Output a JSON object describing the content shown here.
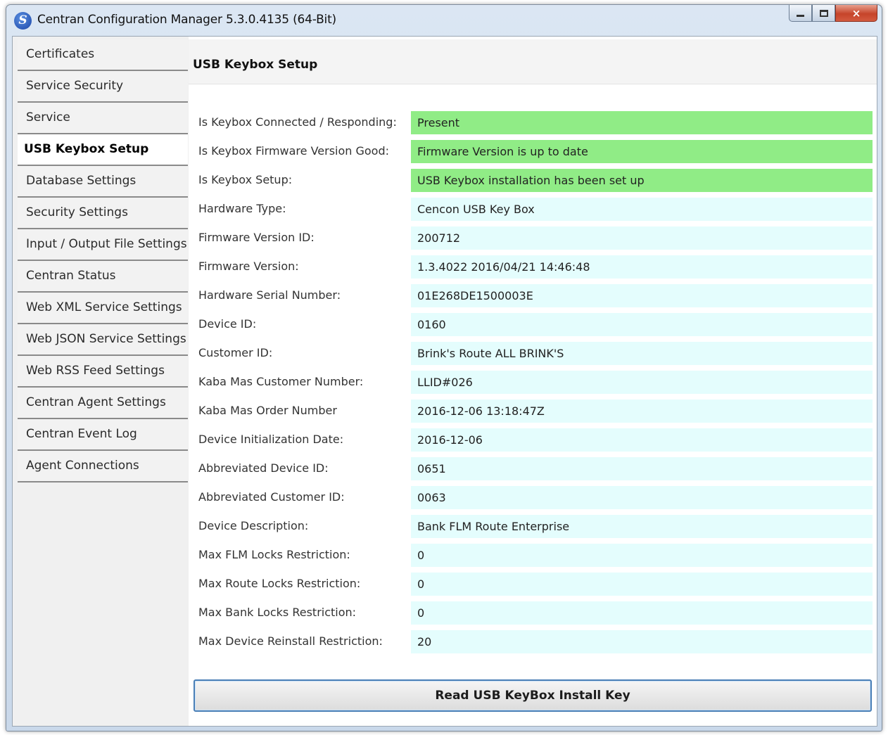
{
  "window": {
    "title": "Centran Configuration Manager 5.3.0.4135 (64-Bit)",
    "icon": "app-logo-icon",
    "controls": {
      "minimize": "minimize-icon",
      "maximize": "maximize-icon",
      "close": "×"
    }
  },
  "sidebar": {
    "items": [
      {
        "label": "Certificates"
      },
      {
        "label": "Service Security"
      },
      {
        "label": "Service"
      },
      {
        "label": "USB Keybox Setup",
        "selected": true
      },
      {
        "label": "Database Settings"
      },
      {
        "label": "Security Settings"
      },
      {
        "label": "Input / Output File Settings"
      },
      {
        "label": "Centran Status"
      },
      {
        "label": "Web XML Service Settings"
      },
      {
        "label": "Web JSON Service Settings"
      },
      {
        "label": "Web RSS Feed Settings"
      },
      {
        "label": "Centran Agent Settings"
      },
      {
        "label": "Centran Event Log"
      },
      {
        "label": "Agent Connections"
      }
    ]
  },
  "main": {
    "title": "USB Keybox Setup",
    "fields": [
      {
        "label": "Is Keybox Connected / Responding:",
        "value": "Present",
        "status": "ok"
      },
      {
        "label": "Is Keybox Firmware Version Good:",
        "value": "Firmware Version is up to date",
        "status": "ok"
      },
      {
        "label": "Is Keybox Setup:",
        "value": "USB Keybox installation has been set up",
        "status": "ok"
      },
      {
        "label": "Hardware Type:",
        "value": "Cencon USB Key Box"
      },
      {
        "label": "Firmware Version ID:",
        "value": "200712"
      },
      {
        "label": "Firmware Version:",
        "value": "1.3.4022 2016/04/21 14:46:48"
      },
      {
        "label": "Hardware Serial Number:",
        "value": "01E268DE1500003E"
      },
      {
        "label": "Device ID:",
        "value": "0160"
      },
      {
        "label": "Customer ID:",
        "value": "Brink's Route ALL BRINK'S"
      },
      {
        "label": "Kaba Mas Customer Number:",
        "value": "LLID#026"
      },
      {
        "label": "Kaba Mas Order Number",
        "value": "2016-12-06 13:18:47Z"
      },
      {
        "label": "Device Initialization Date:",
        "value": "2016-12-06"
      },
      {
        "label": "Abbreviated Device ID:",
        "value": "0651"
      },
      {
        "label": "Abbreviated Customer ID:",
        "value": "0063"
      },
      {
        "label": "Device Description:",
        "value": "Bank FLM Route Enterprise"
      },
      {
        "label": "Max FLM Locks Restriction:",
        "value": "0"
      },
      {
        "label": "Max Route Locks Restriction:",
        "value": "0"
      },
      {
        "label": "Max Bank Locks Restriction:",
        "value": "0"
      },
      {
        "label": "Max Device Reinstall Restriction:",
        "value": "20"
      }
    ],
    "read_button": "Read USB KeyBox Install Key"
  },
  "colors": {
    "ok": "#90ec86",
    "value_bg": "#e4fdfd",
    "button_border": "#4a7fb6"
  }
}
